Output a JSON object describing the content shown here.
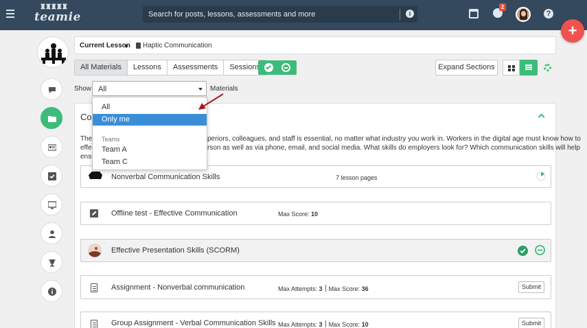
{
  "topbar": {
    "search_placeholder": "Search for posts, lessons, assessments and more",
    "notification_count": "2",
    "help_symbol": "?",
    "info_symbol": "i",
    "brand_name": "teamie",
    "fab_symbol": "+"
  },
  "lesson": {
    "label": "Current Lesson",
    "name": "Haptic Communication"
  },
  "tabs": [
    "All Materials",
    "Lessons",
    "Assessments",
    "Sessions"
  ],
  "active_tab": "All Materials",
  "expand_label": "Expand Sections",
  "filter": {
    "show_label": "Show",
    "selected": "All",
    "suffix": "Materials",
    "options": [
      "All",
      "Only me"
    ],
    "highlighted": "Only me",
    "group_label": "Teams",
    "group_options": [
      "Team A",
      "Team C"
    ]
  },
  "section": {
    "title_visible": "Co",
    "desc_line1_left": "The a",
    "desc_line1_right": "periors, colleagues, and staff is essential, no matter what industry you work in. Workers in the digital age must know how to",
    "desc_line2_left": "effec",
    "desc_line2_right": "rson as well as via phone, email, and social media. What skills do employers look for? Which communication skills will help",
    "desc_line3_left": "ensu"
  },
  "items": [
    {
      "title": "Nonverbal Communication Skills",
      "meta": "7 lesson pages",
      "type": "lesson"
    },
    {
      "title": "Offline test - Effective Communication",
      "meta_label": "Max Score:",
      "meta_value": "10",
      "type": "offline"
    },
    {
      "title": "Effective Presentation Skills (SCORM)",
      "type": "scorm"
    },
    {
      "title": "Assignment - Nonverbal communication",
      "attempts_label": "Max Attempts:",
      "attempts_value": "3",
      "score_label": "Max Score:",
      "score_value": "36",
      "action": "Submit",
      "type": "assignment"
    },
    {
      "title": "Group Assignment - Verbal Communication Skills",
      "attempts_label": "Max Attempts:",
      "attempts_value": "3",
      "score_label": "Max Score:",
      "score_value": "10",
      "action": "Submit",
      "type": "assignment"
    }
  ],
  "colors": {
    "topbar": "#34495e",
    "accent_green": "#3dbb7a",
    "fab_red": "#f0524f",
    "highlight_blue": "#3a8ed7",
    "annotation_red": "#a8191b"
  },
  "rail_icons": [
    "comment-icon",
    "folder-icon",
    "newspaper-icon",
    "checkbox-icon",
    "monitor-icon",
    "user-icon",
    "trophy-icon",
    "info-icon"
  ]
}
